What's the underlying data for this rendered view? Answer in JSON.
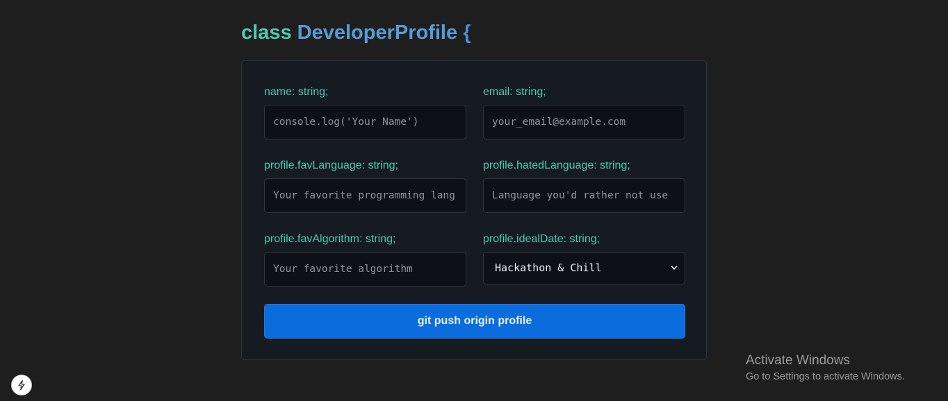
{
  "header": {
    "keyword": "class",
    "class_name": "DeveloperProfile",
    "brace": "{"
  },
  "form": {
    "name": {
      "label": "name: string;",
      "placeholder": "console.log('Your Name')"
    },
    "email": {
      "label": "email: string;",
      "placeholder": "your_email@example.com"
    },
    "fav_language": {
      "label": "profile.favLanguage: string;",
      "placeholder": "Your favorite programming lang"
    },
    "hated_language": {
      "label": "profile.hatedLanguage: string;",
      "placeholder": "Language you'd rather not use"
    },
    "fav_algorithm": {
      "label": "profile.favAlgorithm: string;",
      "placeholder": "Your favorite algorithm"
    },
    "ideal_date": {
      "label": "profile.idealDate: string;",
      "selected": "Hackathon & Chill"
    },
    "submit_label": "git push origin profile"
  },
  "os_overlay": {
    "activate_title": "Activate Windows",
    "activate_subtitle": "Go to Settings to activate Windows."
  },
  "icons": {
    "dev_tools": "lightning-bolt-icon",
    "select_arrow": "chevron-down-icon"
  },
  "colors": {
    "background": "#1e1e1e",
    "card": "#161b22",
    "label": "#4ec9b0",
    "class_name": "#569cd6",
    "button": "#0b6ddd"
  }
}
